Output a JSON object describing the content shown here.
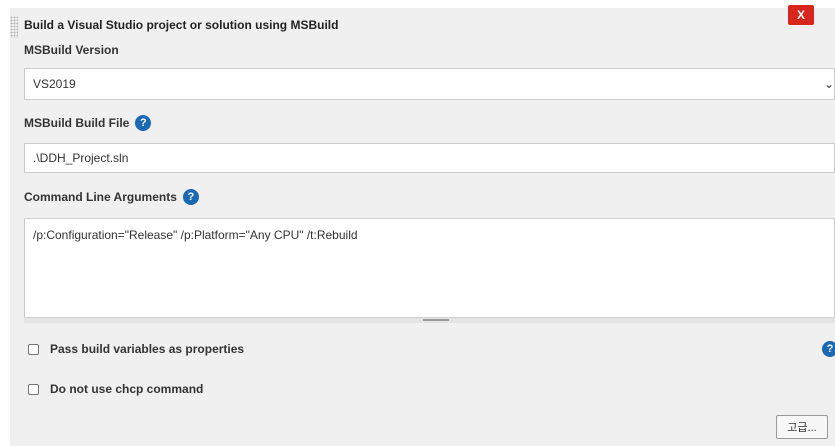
{
  "section": {
    "title": "Build a Visual Studio project or solution using MSBuild",
    "delete_label": "X"
  },
  "msbuild_version": {
    "label": "MSBuild Version",
    "selected": "VS2019",
    "chevron": "⌄"
  },
  "build_file": {
    "label": "MSBuild Build File",
    "value": ".\\DDH_Project.sln",
    "help": "?"
  },
  "command_line": {
    "label": "Command Line Arguments",
    "value": "/p:Configuration=\"Release\" /p:Platform=\"Any CPU\" /t:Rebuild",
    "help": "?"
  },
  "options": {
    "pass_build_variables": "Pass build variables as properties",
    "no_chcp": "Do not use chcp command",
    "help": "?"
  },
  "advanced_button": "고급...",
  "colors": {
    "help_icon": "#1b68b3",
    "delete_button": "#d9261c",
    "panel_bg": "#f0f0f0"
  },
  "icons": {
    "help": "help-icon",
    "delete": "delete-icon",
    "chevron": "chevron-down-icon"
  }
}
